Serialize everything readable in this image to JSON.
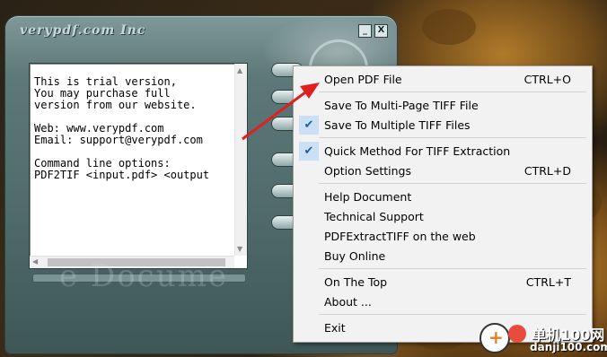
{
  "window": {
    "title": "verypdf.com Inc",
    "minimize_label": "_",
    "close_label": "X"
  },
  "text_panel": {
    "content": "This is trial version,\nYou may purchase full\nversion from our website.\n\nWeb: www.verypdf.com\nEmail: support@verypdf.com\n\nCommand line options:\nPDF2TIF <input.pdf> <output"
  },
  "watermark": "e  Docume",
  "context_menu": {
    "items": [
      {
        "label": "Open PDF File",
        "accel": "CTRL+O",
        "checked": false
      },
      {
        "label": "Save To Multi-Page TIFF File",
        "accel": "",
        "checked": false
      },
      {
        "label": "Save To Multiple TIFF Files",
        "accel": "",
        "checked": true
      },
      {
        "label": "Quick Method For TIFF Extraction",
        "accel": "",
        "checked": true
      },
      {
        "label": "Option Settings",
        "accel": "CTRL+D",
        "checked": false
      },
      {
        "label": "Help Document",
        "accel": "",
        "checked": false
      },
      {
        "label": "Technical Support",
        "accel": "",
        "checked": false
      },
      {
        "label": "PDFExtractTIFF on the web",
        "accel": "",
        "checked": false
      },
      {
        "label": "Buy Online",
        "accel": "",
        "checked": false
      },
      {
        "label": "On The Top",
        "accel": "CTRL+T",
        "checked": false
      },
      {
        "label": "About ...",
        "accel": "",
        "checked": false
      },
      {
        "label": "Exit",
        "accel": "",
        "checked": false
      }
    ],
    "check_glyph": "✔"
  },
  "site_logo": {
    "top_text": "单机100网",
    "bottom_text": "danji100.com"
  },
  "colors": {
    "menu_background": "#f2f2f2",
    "check_highlight": "#cce0f5",
    "arrow": "#e02020"
  }
}
